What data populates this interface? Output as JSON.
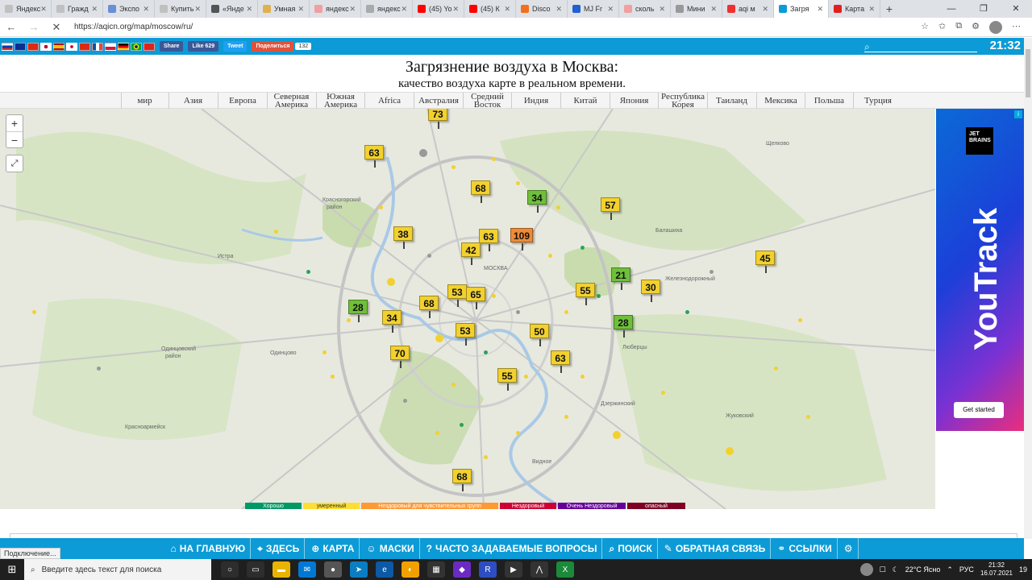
{
  "browser": {
    "tabs": [
      {
        "label": "Яндекс",
        "color": "#c0c0c0"
      },
      {
        "label": "Гражд",
        "color": "#c0c0c0"
      },
      {
        "label": "Экспо",
        "color": "#6a8fd8"
      },
      {
        "label": "Купить",
        "color": "#c0c0c0"
      },
      {
        "label": "«Янде",
        "color": "#555"
      },
      {
        "label": "Умная",
        "color": "#e0b050"
      },
      {
        "label": "яндекс",
        "color": "#f0a0a0"
      },
      {
        "label": "яндекс",
        "color": "#aaa"
      },
      {
        "label": "(45) Yo",
        "color": "#f00"
      },
      {
        "label": "(45) К",
        "color": "#f00"
      },
      {
        "label": "Disco",
        "color": "#f07020"
      },
      {
        "label": "MJ Fr",
        "color": "#2060d0"
      },
      {
        "label": "сколь",
        "color": "#f0a0a0"
      },
      {
        "label": "Мини",
        "color": "#999"
      },
      {
        "label": "aqi м",
        "color": "#f03030"
      },
      {
        "label": "Загря",
        "color": "#0c9bd6",
        "active": true
      },
      {
        "label": "Карта",
        "color": "#e02020"
      }
    ],
    "url": "https://aqicn.org/map/moscow/ru/",
    "status": "Подключение..."
  },
  "site": {
    "share_fb": "Share",
    "like_fb": "Like 629",
    "tweet": "Tweet",
    "share_ok": "Поделиться",
    "share_count": "132",
    "clock": "21:32",
    "title": "Загрязнение воздуха в Москва:",
    "subtitle": "качество воздуха карте в реальном времени."
  },
  "regions": [
    "мир",
    "Азия",
    "Европа",
    "Северная Америка",
    "Южная Америка",
    "Africa",
    "Австралия",
    "Средний Восток",
    "Индия",
    "Китай",
    "Япония",
    "Республика Корея",
    "Таиланд",
    "Мексика",
    "Польша",
    "Турция"
  ],
  "map": {
    "stations": [
      {
        "value": "73",
        "level": "yellow"
      },
      {
        "value": "63",
        "level": "yellow"
      },
      {
        "value": "68",
        "level": "yellow"
      },
      {
        "value": "34",
        "level": "green"
      },
      {
        "value": "57",
        "level": "yellow"
      },
      {
        "value": "38",
        "level": "yellow"
      },
      {
        "value": "63",
        "level": "yellow"
      },
      {
        "value": "109",
        "level": "orange"
      },
      {
        "value": "42",
        "level": "yellow"
      },
      {
        "value": "45",
        "level": "yellow"
      },
      {
        "value": "21",
        "level": "green"
      },
      {
        "value": "30",
        "level": "yellow"
      },
      {
        "value": "53",
        "level": "yellow"
      },
      {
        "value": "65",
        "level": "yellow"
      },
      {
        "value": "55",
        "level": "yellow"
      },
      {
        "value": "68",
        "level": "yellow"
      },
      {
        "value": "28",
        "level": "green"
      },
      {
        "value": "34",
        "level": "yellow"
      },
      {
        "value": "53",
        "level": "yellow"
      },
      {
        "value": "28",
        "level": "green"
      },
      {
        "value": "50",
        "level": "yellow"
      },
      {
        "value": "70",
        "level": "yellow"
      },
      {
        "value": "63",
        "level": "yellow"
      },
      {
        "value": "55",
        "level": "yellow"
      },
      {
        "value": "68",
        "level": "yellow"
      }
    ],
    "legend": [
      {
        "label": "Хорошо",
        "color": "#009966"
      },
      {
        "label": "умеренный",
        "color": "#ffde33"
      },
      {
        "label": "Нездоровый для чувствительных групп",
        "color": "#ff9933"
      },
      {
        "label": "Нездоровый",
        "color": "#cc0033"
      },
      {
        "label": "Очень Нездоровый",
        "color": "#660099"
      },
      {
        "label": "опасный",
        "color": "#7e0023"
      }
    ]
  },
  "ad": {
    "brand_logo": "JET BRAINS",
    "product": "YouTrack",
    "cta": "Get started"
  },
  "bottom_nav": [
    "НА ГЛАВНУЮ",
    "ЗДЕСЬ",
    "КАРТА",
    "МАСКИ",
    "ЧАСТО ЗАДАВАЕМЫЕ ВОПРОСЫ",
    "ПОИСК",
    "ОБРАТНАЯ СВЯЗЬ",
    "ССЫЛКИ"
  ],
  "taskbar": {
    "search_placeholder": "Введите здесь текст для поиска",
    "weather": "22°C Ясно",
    "lang": "РУС",
    "time": "21:32",
    "date": "16.07.2021",
    "notifications": "19"
  }
}
